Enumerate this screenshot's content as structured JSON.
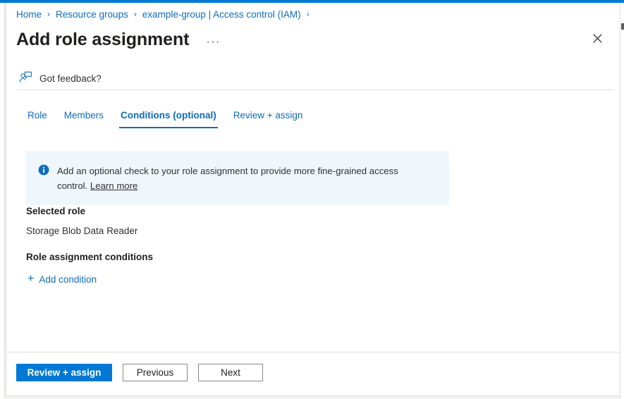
{
  "theme": {
    "accent": "#0078d4",
    "link": "#0f6cbd",
    "info_banner_bg": "#eff6fc",
    "border": "#e1dfdd",
    "text": "#323130"
  },
  "breadcrumb": {
    "separator": "›",
    "items": [
      {
        "label": "Home"
      },
      {
        "label": "Resource groups"
      },
      {
        "label": "example-group | Access control (IAM)"
      }
    ],
    "trailing_separator": "›"
  },
  "header": {
    "title": "Add role assignment",
    "more_menu_label": "···",
    "more_menu_icon": "ellipsis-icon",
    "close_icon": "close-icon"
  },
  "feedback": {
    "label": "Got feedback?",
    "icon": "feedback-person-icon"
  },
  "tabs": [
    {
      "label": "Role",
      "active": false
    },
    {
      "label": "Members",
      "active": false
    },
    {
      "label": "Conditions (optional)",
      "active": true
    },
    {
      "label": "Review + assign",
      "active": false
    }
  ],
  "info_banner": {
    "icon": "info-circle-icon",
    "text": "Add an optional check to your role assignment to provide more fine-grained access control.",
    "link_label": "Learn more"
  },
  "content": {
    "selected_role_heading": "Selected role",
    "selected_role_value": "Storage Blob Data Reader",
    "conditions_heading": "Role assignment conditions",
    "add_condition_label": "Add condition",
    "add_condition_icon": "plus-icon",
    "plus_glyph": "+"
  },
  "footer": {
    "primary_label": "Review + assign",
    "previous_label": "Previous",
    "next_label": "Next"
  }
}
